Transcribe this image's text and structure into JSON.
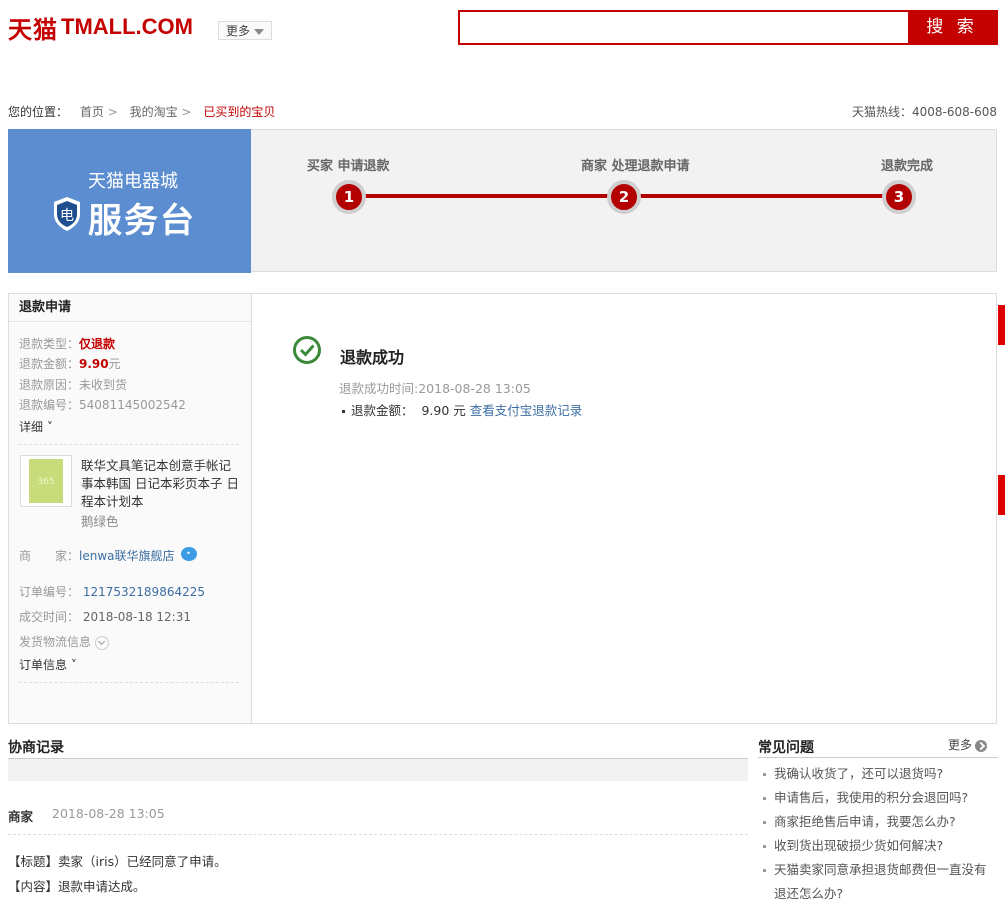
{
  "header": {
    "logo_cn": "天猫",
    "logo_en": "TMALL.COM",
    "more_label": "更多",
    "search_placeholder": "",
    "search_button": "搜 索"
  },
  "breadcrumb": {
    "prefix": "您的位置：",
    "items": [
      "首页",
      "我的淘宝",
      "已买到的宝贝"
    ],
    "hotline": "天猫热线：4008-608-608"
  },
  "banner": {
    "service_sub": "天猫电器城",
    "service_main": "服务台",
    "steps": [
      {
        "num": "1",
        "label": "买家 申请退款"
      },
      {
        "num": "2",
        "label": "商家 处理退款申请"
      },
      {
        "num": "3",
        "label": "退款完成"
      }
    ],
    "colors": {
      "accent": "#b30000",
      "service_bg": "#5b8dd0"
    }
  },
  "refund": {
    "title": "退款申请",
    "type_label": "退款类型：",
    "type_value": "仅退款",
    "amount_label": "退款金额：",
    "amount_value": "9.90",
    "amount_unit": "元",
    "reason_label": "退款原因：",
    "reason_value": "未收到货",
    "number_label": "退款编号：",
    "number_value": "54081145002542",
    "detail_toggle": "详细",
    "product_name": "联华文具笔记本创意手帐记事本韩国 日记本彩页本子 日程本计划本",
    "product_thumb_text": "365",
    "product_color": "鹅绿色",
    "merchant_label": "商　　家：",
    "merchant_value": "lenwa联华旗舰店",
    "order_label": "订单编号：",
    "order_value": "1217532189864225",
    "deal_label": "成交时间：",
    "deal_value": "2018-08-18 12:31",
    "logistics": "发货物流信息",
    "order_info": "订单信息"
  },
  "success": {
    "title": "退款成功",
    "time": "退款成功时间:2018-08-28 13:05",
    "amount_label": "退款金额：",
    "amount_value": "9.90 元",
    "record_link": "查看支付宝退款记录"
  },
  "negotiation": {
    "title": "协商记录",
    "role": "商家",
    "time": "2018-08-28 13:05",
    "line1": "【标题】卖家（iris）已经同意了申请。",
    "line2": "【内容】退款申请达成。"
  },
  "faq": {
    "title": "常见问题",
    "more": "更多",
    "items": [
      "我确认收货了，还可以退货吗?",
      "申请售后，我使用的积分会退回吗?",
      "商家拒绝售后申请，我要怎么办?",
      "收到货出现破损少货如何解决?",
      "天猫卖家同意承担退货邮费但一直没有退还怎么办?"
    ]
  }
}
